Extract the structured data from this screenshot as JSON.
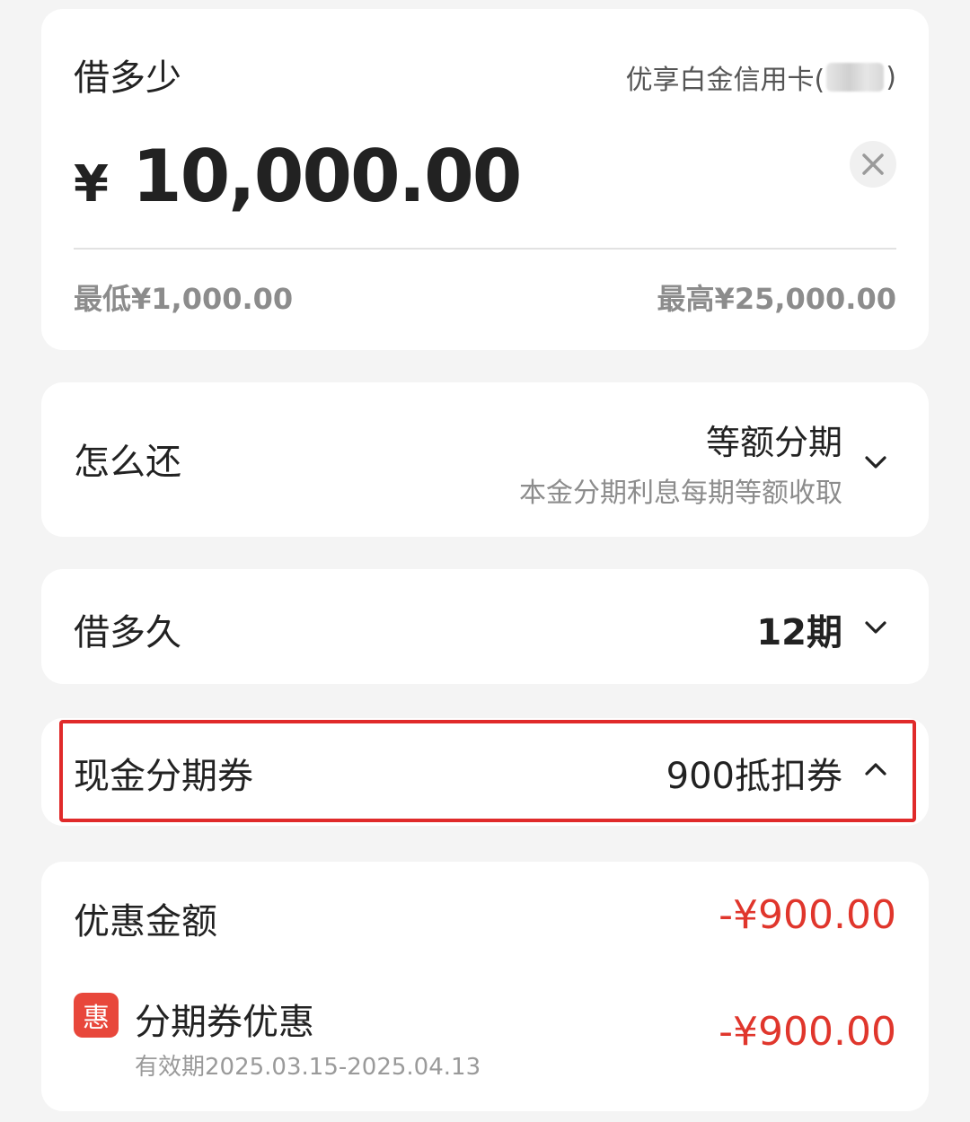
{
  "loan": {
    "title": "借多少",
    "card_prefix": "优享白金信用卡(",
    "card_suffix": ")",
    "currency_symbol": "¥",
    "amount": "10,000.00",
    "min": "最低¥1,000.00",
    "max": "最高¥25,000.00"
  },
  "repayment": {
    "title": "怎么还",
    "method": "等额分期",
    "description": "本金分期利息每期等额收取"
  },
  "term": {
    "title": "借多久",
    "value": "12期"
  },
  "coupon": {
    "title": "现金分期券",
    "value": "900抵扣券"
  },
  "discount": {
    "title": "优惠金额",
    "total": "-¥900.00",
    "badge": "惠",
    "item_label": "分期券优惠",
    "item_validity": "有效期2025.03.15-2025.04.13",
    "item_amount": "-¥900.00"
  },
  "colors": {
    "accent_red": "#e0362c",
    "highlight_border": "#e02a2a",
    "badge_bg": "#e8473b"
  }
}
